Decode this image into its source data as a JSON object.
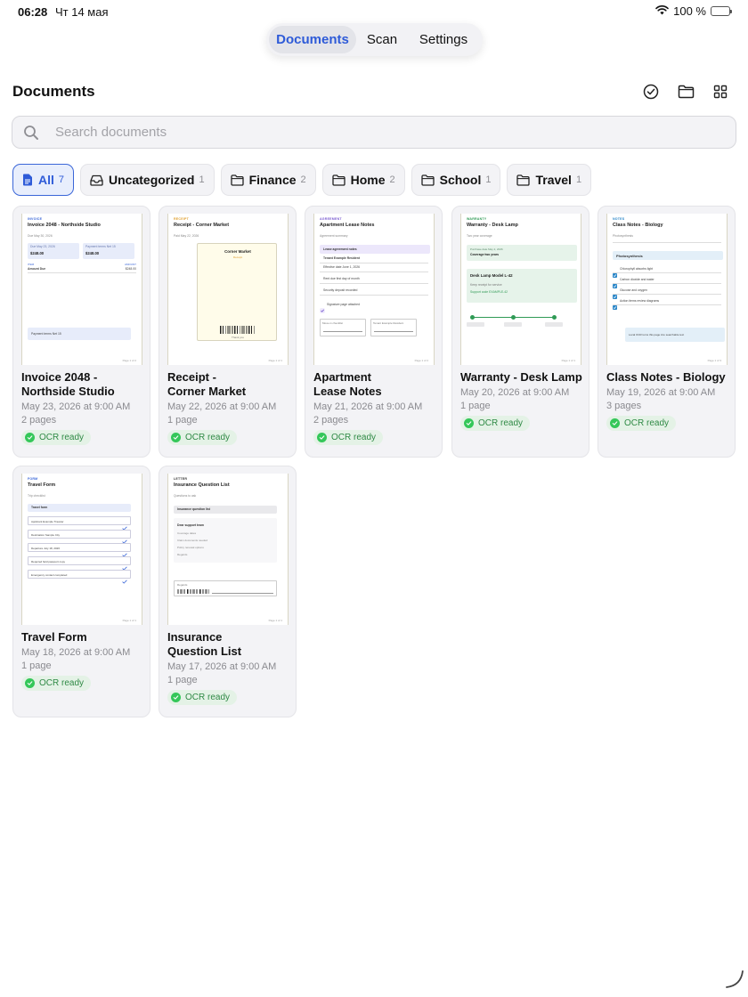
{
  "status_bar": {
    "time": "06:28",
    "date": "Чт 14 мая",
    "battery": "100 %"
  },
  "nav": {
    "tabs": [
      "Documents",
      "Scan",
      "Settings"
    ],
    "active": "Documents"
  },
  "header": {
    "title": "Documents",
    "icons": [
      "select-checkmark-icon",
      "folder-icon",
      "grid-view-icon"
    ]
  },
  "search": {
    "placeholder": "Search documents",
    "value": ""
  },
  "filters": [
    {
      "label": "All",
      "count": "7",
      "icon": "document-icon",
      "active": true
    },
    {
      "label": "Uncategorized",
      "count": "1",
      "icon": "tray-icon"
    },
    {
      "label": "Finance",
      "count": "2",
      "icon": "folder-icon"
    },
    {
      "label": "Home",
      "count": "2",
      "icon": "folder-icon"
    },
    {
      "label": "School",
      "count": "1",
      "icon": "folder-icon"
    },
    {
      "label": "Travel",
      "count": "1",
      "icon": "folder-icon"
    }
  ],
  "accent_color": "#2e5bd8",
  "ocr_color": "#34c759",
  "documents": [
    {
      "title_lines": [
        "Invoice 2048 -",
        "Northside Studio"
      ],
      "date": "May 23, 2026 at 9:00 AM",
      "pages": "2 pages",
      "badge": "OCR ready",
      "thumb": {
        "kind": "INVOICE",
        "title": "Invoice 2048 - Northside Studio",
        "sub": "Due May 30, 2026",
        "box1_label": "Due May 23, 2026",
        "box1_value": "$248.00",
        "box2_label": "Payment terms Net 15",
        "box2_value": "$248.00",
        "col1": "ITEM",
        "col2": "AMOUNT",
        "row_label": "Amount Due",
        "row_value": "$248.00",
        "footer": "Payment terms Net 15",
        "page": "Page 1 of 2"
      }
    },
    {
      "title_lines": [
        "Receipt -",
        "Corner Market"
      ],
      "date": "May 22, 2026 at 9:00 AM",
      "pages": "1 page",
      "badge": "OCR ready",
      "thumb": {
        "kind": "RECEIPT",
        "title": "Receipt - Corner Market",
        "sub": "Paid May 22, 2026",
        "store": "Corner Market",
        "status": "Receipt",
        "thanks": "Thank you",
        "page": "Page 1 of 1"
      }
    },
    {
      "title_lines": [
        "Apartment",
        "Lease Notes"
      ],
      "date": "May 21, 2026 at 9:00 AM",
      "pages": "2 pages",
      "badge": "OCR ready",
      "thumb": {
        "kind": "AGREEMENT",
        "title": "Apartment Lease Notes",
        "sub": "Agreement summary",
        "band_title": "Lease agreement notes",
        "band_sub": "Tenant Example Resident",
        "rows": [
          "Effective date June 1, 2026",
          "Rent due first day of month",
          "Security deposit recorded"
        ],
        "check": "Signature page attached",
        "sig1": "Move-in checklist",
        "sig2": "Tenant Example Resident",
        "page": "Page 1 of 2"
      }
    },
    {
      "title_lines": [
        "Warranty - Desk Lamp"
      ],
      "date": "May 20, 2026 at 9:00 AM",
      "pages": "1 page",
      "badge": "OCR ready",
      "thumb": {
        "kind": "WARRANTY",
        "title": "Warranty - Desk Lamp",
        "sub": "Two year coverage",
        "box1_label": "Purchase date May 2, 2026",
        "box1_value": "Coverage two years",
        "model": "Desk Lamp Model L-42",
        "model_sub": "Keep receipt for service",
        "code": "Support code EXAMPLE-42",
        "page": "Page 1 of 1"
      }
    },
    {
      "title_lines": [
        "Class Notes - Biology"
      ],
      "date": "May 19, 2026 at 9:00 AM",
      "pages": "3 pages",
      "badge": "OCR ready",
      "thumb": {
        "kind": "NOTES",
        "title": "Class Notes - Biology",
        "sub": "Photosynthesis",
        "band": "Photosynthesis",
        "items": [
          "Chlorophyll absorbs light",
          "Carbon dioxide and water",
          "Glucose and oxygen",
          "Action items review diagrams"
        ],
        "footer": "Local OCR turns this page into searchable text",
        "page": "Page 1 of 3"
      }
    },
    {
      "title_lines": [
        "Travel Form"
      ],
      "date": "May 18, 2026 at 9:00 AM",
      "pages": "1 page",
      "badge": "OCR ready",
      "thumb": {
        "kind": "FORM",
        "title": "Travel Form",
        "sub": "Trip checklist",
        "band": "Travel form",
        "items": [
          "Applicant Example Traveler",
          "Destination Sample City",
          "Departure July 18, 2026",
          "Required field passport copy",
          "Emergency contact completed"
        ],
        "page": "Page 1 of 1"
      }
    },
    {
      "title_lines": [
        "Insurance",
        "Question List"
      ],
      "date": "May 17, 2026 at 9:00 AM",
      "pages": "1 page",
      "badge": "OCR ready",
      "thumb": {
        "kind": "LETTER",
        "title": "Insurance Question List",
        "sub": "Questions to ask",
        "band": "Insurance question list",
        "greeting": "Dear support team",
        "lines": [
          "Coverage dates",
          "Claim documents needed",
          "Policy renewal options",
          "Regards"
        ],
        "sig": "Regards",
        "page": "Page 1 of 1"
      }
    }
  ]
}
